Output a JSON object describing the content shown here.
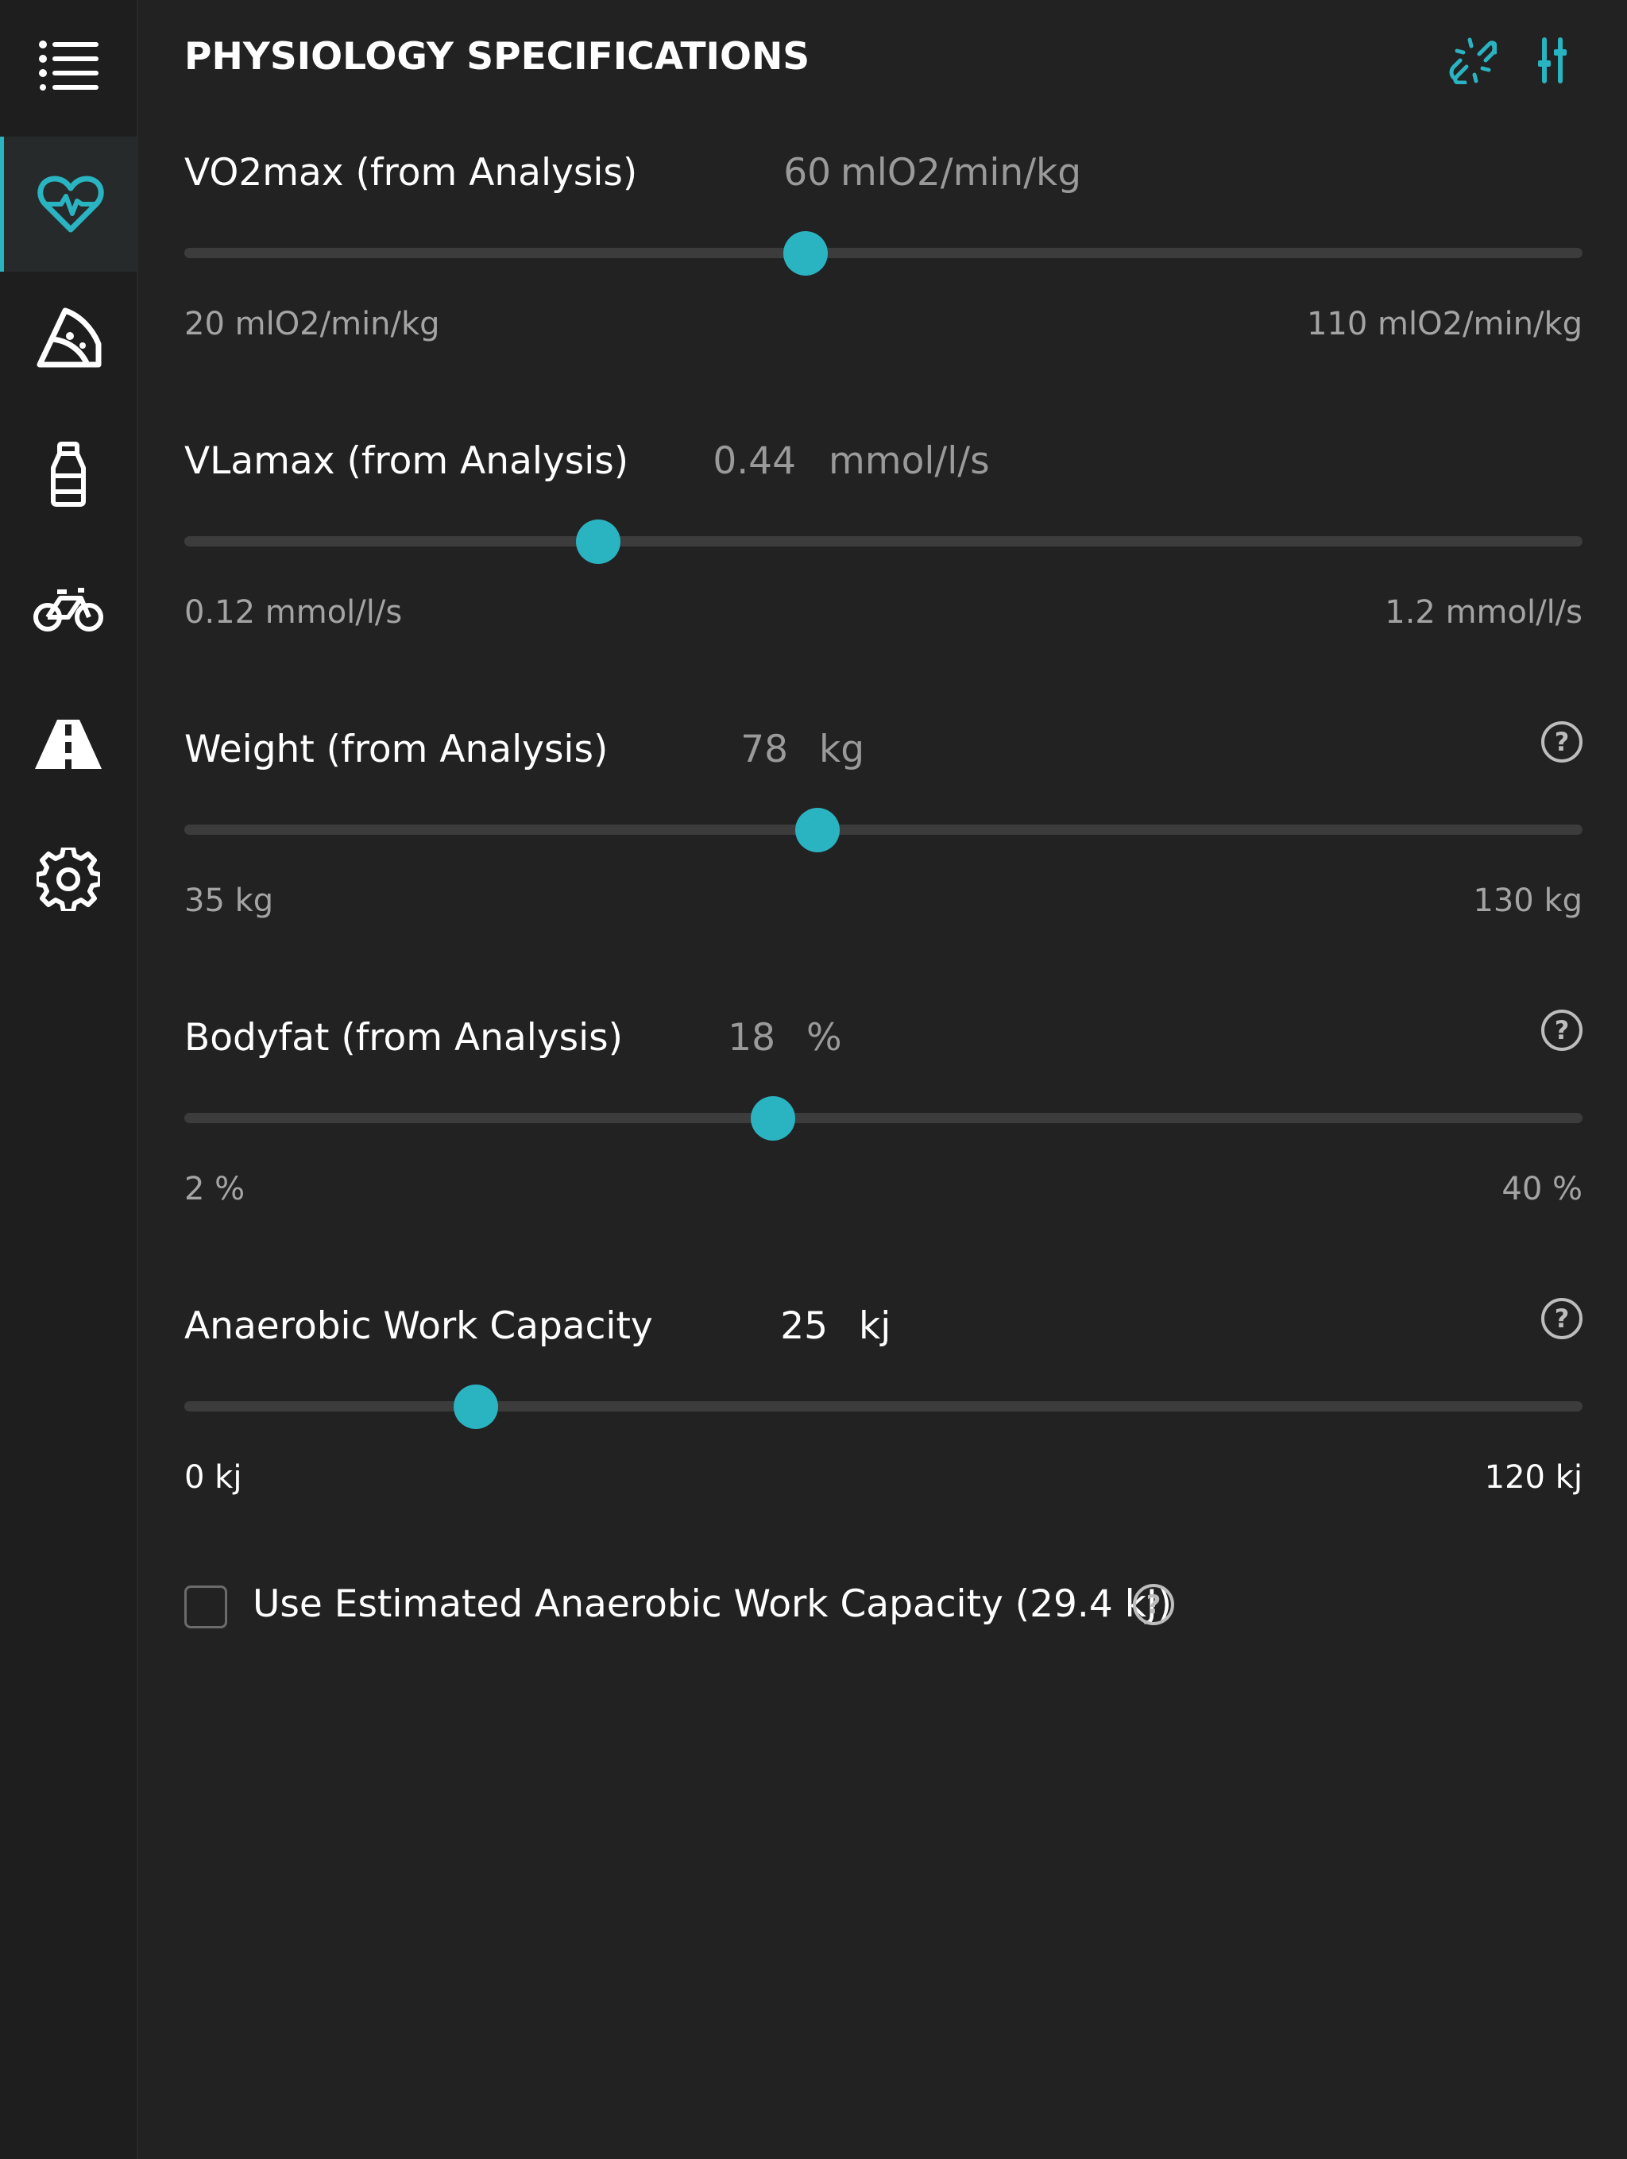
{
  "header": {
    "title": "PHYSIOLOGY SPECIFICATIONS"
  },
  "icons": {
    "menu": "menu-icon",
    "heart": "heart-pulse-icon",
    "pizza": "pizza-icon",
    "bottle": "bottle-icon",
    "bike": "bicycle-icon",
    "road": "road-icon",
    "gear": "gear-icon",
    "unlink": "unlink-icon",
    "sliders": "sliders-icon"
  },
  "colors": {
    "accent": "#2ab3c1",
    "background": "#222222",
    "sidebar": "#1e1e1e"
  },
  "sliders": [
    {
      "label": "VO2max (from Analysis)",
      "value": "60",
      "unit": "mlO2/min/kg",
      "min_label": "20 mlO2/min/kg",
      "max_label": "110 mlO2/min/kg",
      "min": 20,
      "max": 110,
      "current": 60,
      "help": false
    },
    {
      "label": "VLamax (from Analysis)",
      "value": "0.44",
      "unit": "mmol/l/s",
      "min_label": "0.12 mmol/l/s",
      "max_label": "1.2 mmol/l/s",
      "min": 0.12,
      "max": 1.2,
      "current": 0.44,
      "help": false
    },
    {
      "label": "Weight (from Analysis)",
      "value": "78",
      "unit": "kg",
      "min_label": "35 kg",
      "max_label": "130 kg",
      "min": 35,
      "max": 130,
      "current": 78,
      "help": true
    },
    {
      "label": "Bodyfat (from Analysis)",
      "value": "18",
      "unit": "%",
      "min_label": "2 %",
      "max_label": "40 %",
      "min": 2,
      "max": 40,
      "current": 18,
      "help": true
    },
    {
      "label": "Anaerobic Work Capacity",
      "value": "25",
      "unit": "kj",
      "min_label": "0 kj",
      "max_label": "120 kj",
      "min": 0,
      "max": 120,
      "current": 25,
      "help": true
    }
  ],
  "checkbox": {
    "label": "Use Estimated Anaerobic Work Capacity (29.4 kJ)",
    "checked": false
  },
  "help_glyph": "?"
}
